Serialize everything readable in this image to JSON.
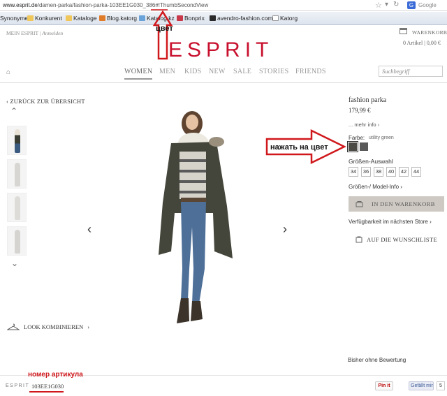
{
  "browser": {
    "url_prefix": "www.esprit.de",
    "url_rest": "/damen-parka/fashion-parka-103EE1G030_386#!ThumbSecondView",
    "search_engine_icon": "G",
    "search_engine_label": "Google"
  },
  "bookmarks": [
    {
      "label": "Synonyme",
      "icon": "none",
      "color": "#ffffff"
    },
    {
      "label": "Konkurent",
      "icon": "folder-icon",
      "color": "#f0c75a"
    },
    {
      "label": "Kataloge",
      "icon": "folder-icon",
      "color": "#f0c75a"
    },
    {
      "label": "Blog.katorg",
      "icon": "blog-icon",
      "color": "#e07b2a"
    },
    {
      "label": "Katalog.kz",
      "icon": "site-icon",
      "color": "#69a3d9"
    },
    {
      "label": "Bonprix",
      "icon": "site-icon",
      "color": "#c83a4a"
    },
    {
      "label": "avendro-fashion.com",
      "icon": "site-icon",
      "color": "#2a2a2a"
    },
    {
      "label": "Katorg",
      "icon": "page-icon",
      "color": "#ffffff"
    }
  ],
  "header": {
    "my_esprit": "MEIN ESPRIT",
    "login": "Anmelden",
    "logo": "ESPRIT",
    "cart_label": "WARENKORB",
    "cart_count": "0 Artikel | 0,00 €"
  },
  "nav": {
    "items": [
      "WOMEN",
      "MEN",
      "KIDS",
      "NEW",
      "SALE",
      "STORIES",
      "FRIENDS"
    ],
    "active": "WOMEN",
    "search_placeholder": "Suchbegriff"
  },
  "left": {
    "back_link": "ZURÜCK ZUR ÜBERSICHT",
    "look_link": "LOOK KOMBINIEREN"
  },
  "product": {
    "name": "fashion parka",
    "price": "179,99 €",
    "more_info": "... mehr info",
    "color_label": "Farbe:",
    "color_value": "utility green",
    "swatches": [
      "#4c4a44",
      "#5a5a5a"
    ],
    "size_label": "Größen-Auswahl",
    "sizes": [
      "34",
      "36",
      "38",
      "40",
      "42",
      "44"
    ],
    "model_info": "Größen-/ Model-Info",
    "add_to_cart": "IN DEN WARENKORB",
    "availability": "Verfügbarkeit im nächsten Store",
    "wishlist": "AUF DIE WUNSCHLISTE",
    "rating": "Bisher ohne Bewertung"
  },
  "footer": {
    "logo": "ESPRIT",
    "article_number": "103EE1G030",
    "pinit": "Pin it",
    "fb_like": "Gefällt mir",
    "fb_count": "5"
  },
  "annotations": {
    "color_top": "цвет",
    "click_color": "нажать на цвет",
    "article_label": "номер артикула"
  },
  "colors": {
    "brand_red": "#c8102e",
    "annotation_red": "#d0181c",
    "cart_button": "#cfc9c3"
  }
}
